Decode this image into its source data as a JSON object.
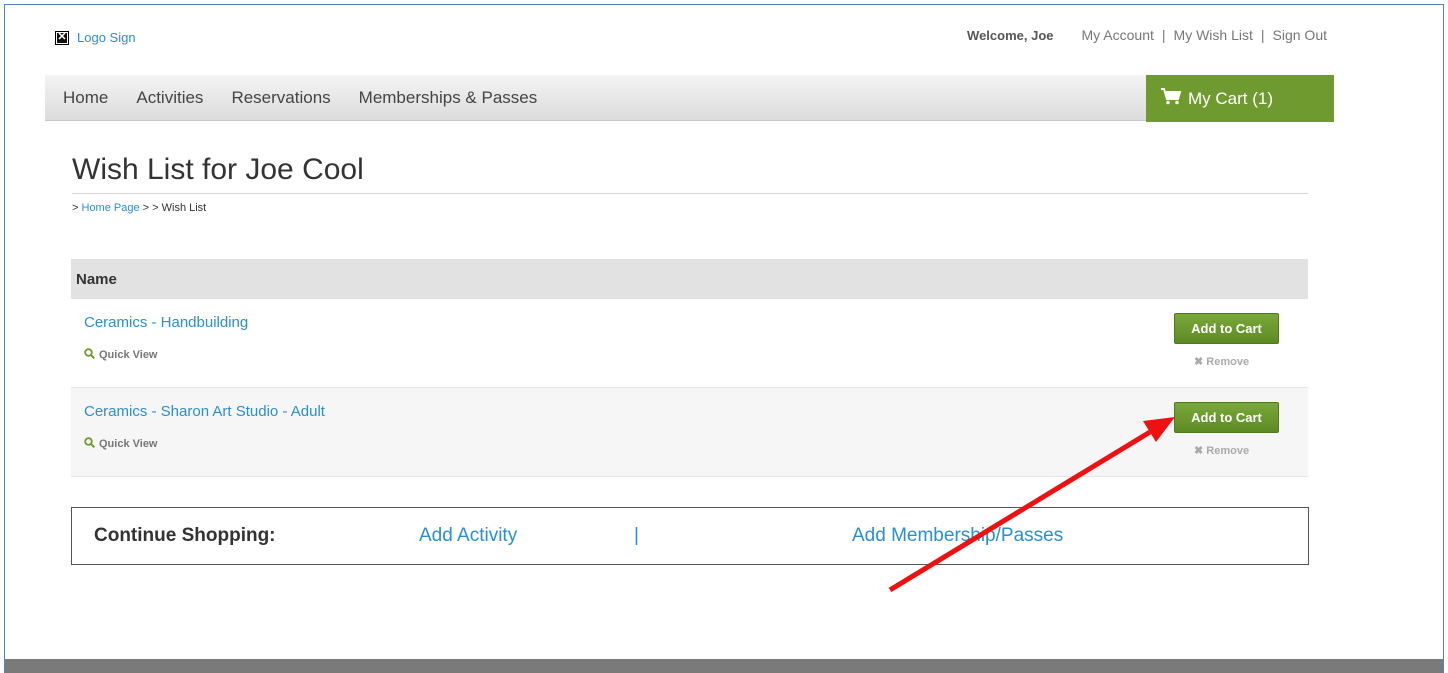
{
  "header": {
    "logo_text": "Logo Sign",
    "logo_icon": "broken-image-icon",
    "welcome": "Welcome, Joe",
    "links": [
      "My Account",
      "My Wish List",
      "Sign Out"
    ],
    "separator": "|"
  },
  "nav": {
    "items": [
      "Home",
      "Activities",
      "Reservations",
      "Memberships & Passes"
    ],
    "cart_label": "My Cart (1)",
    "cart_icon": "cart-icon",
    "cart_color": "#6f9a2f"
  },
  "page": {
    "title": "Wish List for Joe Cool",
    "breadcrumb": {
      "prefix": ">",
      "home": "Home Page",
      "mid": "> > Wish List"
    }
  },
  "table": {
    "header": "Name",
    "rows": [
      {
        "name": "Ceramics - Handbuilding",
        "quick_view": "Quick View",
        "add_label": "Add to Cart",
        "remove_label": "Remove"
      },
      {
        "name": "Ceramics - Sharon Art Studio - Adult",
        "quick_view": "Quick View",
        "add_label": "Add to Cart",
        "remove_label": "Remove"
      }
    ]
  },
  "continue": {
    "label": "Continue Shopping:",
    "link1": "Add Activity",
    "separator": "|",
    "link2": "Add Membership/Passes"
  },
  "annotation": {
    "arrow_color": "#ee1111"
  }
}
